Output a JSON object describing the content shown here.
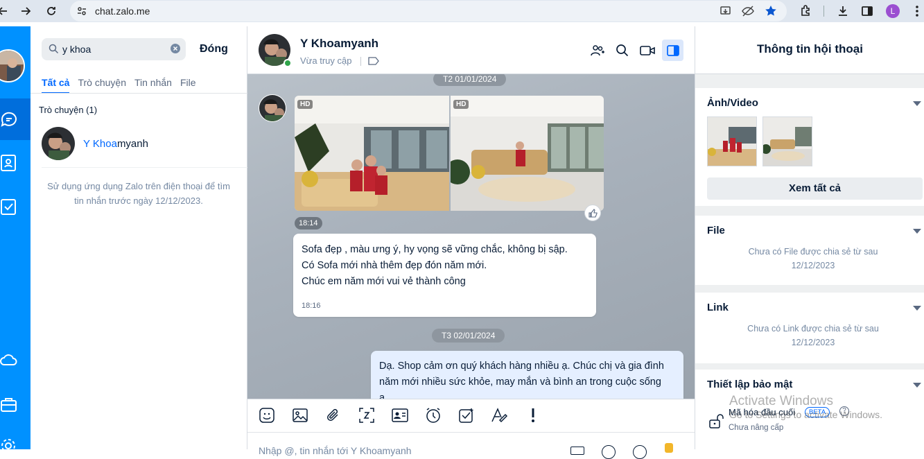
{
  "browser": {
    "url": "chat.zalo.me",
    "profile_initial": "L",
    "profile_color": "#9b4fd1"
  },
  "search": {
    "query": "y khoa",
    "close_label": "Đóng"
  },
  "tabs": [
    {
      "label": "Tất cả",
      "active": true
    },
    {
      "label": "Trò chuyện",
      "active": false
    },
    {
      "label": "Tin nhắn",
      "active": false
    },
    {
      "label": "File",
      "active": false
    }
  ],
  "results": {
    "section_title": "Trò chuyện (1)",
    "name_highlight": "Y Khoa",
    "name_rest": "myanh",
    "note": "Sử dụng ứng dụng Zalo trên điện thoại để tìm tin nhắn trước ngày 12/12/2023."
  },
  "chat": {
    "name": "Y Khoamyanh",
    "status": "Vừa truy cập",
    "date1": "T2 01/01/2024",
    "hd": "HD",
    "img_time": "18:14",
    "msg1": {
      "lines": [
        "Sofa đẹp , màu ưng ý, hy vọng sẽ vững chắc, không bị sập.",
        "Có Sofa mới nhà thêm đẹp đón năm mới.",
        "Chúc em năm mới vui vẻ thành công"
      ],
      "time": "18:16"
    },
    "date2": "T3 02/01/2024",
    "msg2": {
      "lines": [
        "Dạ. Shop cảm ơn quý khách hàng nhiều ạ. Chúc chị và gia đình",
        "năm mới nhiều sức khỏe, may mắn và bình an trong cuộc sống",
        "ạ"
      ]
    },
    "input_placeholder": "Nhập @, tin nhắn tới Y Khoamyanh"
  },
  "info": {
    "title": "Thông tin hội thoại",
    "media_title": "Ảnh/Video",
    "see_all": "Xem tất cả",
    "file_title": "File",
    "file_note": "Chưa có File được chia sẻ từ sau 12/12/2023",
    "link_title": "Link",
    "link_note": "Chưa có Link được chia sẻ từ sau 12/12/2023",
    "security_title": "Thiết lập bảo mật",
    "e2e_label": "Mã hóa đầu cuối",
    "beta": "BETA",
    "upgrade": "Chưa nâng cấp"
  },
  "watermark": {
    "line1": "Activate Windows",
    "line2": "Go to Settings to activate Windows."
  },
  "colors": {
    "brand": "#0091ff",
    "brand_active": "#006edc",
    "accent": "#0068ff"
  }
}
